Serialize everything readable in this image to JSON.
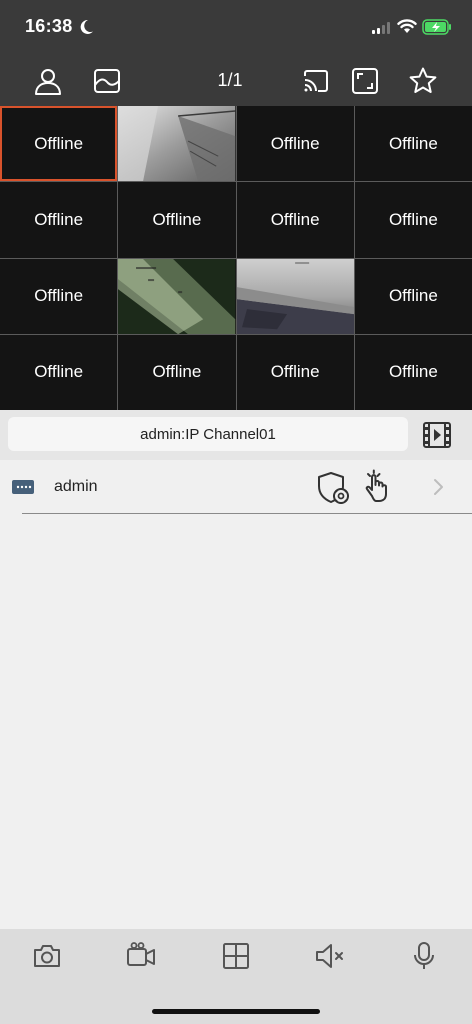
{
  "status_bar": {
    "time": "16:38"
  },
  "toolbar": {
    "page_indicator": "1/1",
    "icons": [
      "user-icon",
      "image-icon",
      "cast-icon",
      "fullscreen-icon",
      "star-icon"
    ]
  },
  "grid": {
    "offline_label": "Offline",
    "cells": [
      {
        "type": "offline",
        "label": "Offline",
        "selected": true
      },
      {
        "type": "video",
        "scene": "ceiling"
      },
      {
        "type": "offline",
        "label": "Offline"
      },
      {
        "type": "offline",
        "label": "Offline"
      },
      {
        "type": "offline",
        "label": "Offline"
      },
      {
        "type": "offline",
        "label": "Offline"
      },
      {
        "type": "offline",
        "label": "Offline"
      },
      {
        "type": "offline",
        "label": "Offline"
      },
      {
        "type": "offline",
        "label": "Offline"
      },
      {
        "type": "video",
        "scene": "night-green"
      },
      {
        "type": "video",
        "scene": "room-floor"
      },
      {
        "type": "offline",
        "label": "Offline"
      },
      {
        "type": "offline",
        "label": "Offline"
      },
      {
        "type": "offline",
        "label": "Offline"
      },
      {
        "type": "offline",
        "label": "Offline"
      },
      {
        "type": "offline",
        "label": "Offline"
      }
    ]
  },
  "channel": {
    "label": "admin:IP Channel01"
  },
  "device": {
    "name": "admin"
  },
  "bottom_bar": {
    "icons": [
      "camera-icon",
      "video-record-icon",
      "grid-layout-icon",
      "mute-icon",
      "microphone-icon"
    ]
  },
  "colors": {
    "bar": "#3a3a3a",
    "selected_border": "#d9532c",
    "battery": "#4cd964"
  }
}
